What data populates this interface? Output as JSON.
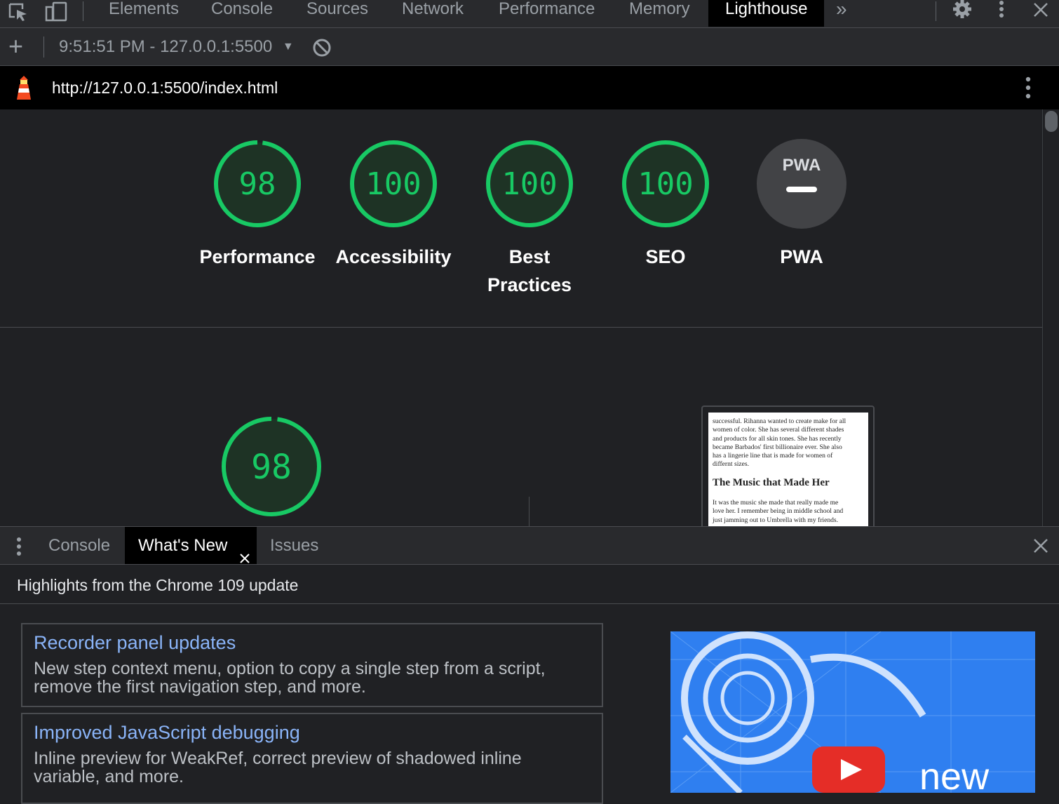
{
  "devtools": {
    "tabs": [
      "Elements",
      "Console",
      "Sources",
      "Network",
      "Performance",
      "Memory",
      "Lighthouse"
    ],
    "active_tab": "Lighthouse",
    "more_tabs": "»"
  },
  "toolbar": {
    "add_label": "+",
    "report_selector": "9:51:51 PM - 127.0.0.1:5500",
    "dropdown_arrow": "▼"
  },
  "urlbar": {
    "url": "http://127.0.0.1:5500/index.html"
  },
  "categories": [
    {
      "score": "98",
      "label": "Performance",
      "value": 98
    },
    {
      "score": "100",
      "label": "Accessibility",
      "value": 100
    },
    {
      "score": "100",
      "label": "Best Practices",
      "label_line1": "Best",
      "label_line2": "Practices",
      "value": 100
    },
    {
      "score": "100",
      "label": "SEO",
      "value": 100
    },
    {
      "score": "",
      "label": "PWA",
      "badge": "PWA"
    }
  ],
  "performance_detail": {
    "score": "98",
    "value": 98
  },
  "screenshot": {
    "para1_lines": [
      "successful. Rihanna wanted to create make for all",
      "women of color. She has several different shades",
      "and products for all skin tones. She has recently",
      "became Barbados' first billionaire ever. She also",
      "has a lingerie line that is made for women of",
      "differnt sizes."
    ],
    "heading": "The Music that Made Her",
    "para2_lines": [
      "It was the music she made that really made me",
      "love her. I remember being in middle school and",
      "just jamming out to Umbrella with my friends."
    ]
  },
  "drawer": {
    "tabs": [
      "Console",
      "What's New",
      "Issues"
    ],
    "active_tab": "What's New",
    "highlights_title": "Highlights from the Chrome 109 update",
    "cards": [
      {
        "title": "Recorder panel updates",
        "desc_line1": "New step context menu, option to copy a single step from a script,",
        "desc_line2": "remove the first navigation step, and more."
      },
      {
        "title": "Improved JavaScript debugging",
        "desc_line1": "Inline preview for WeakRef, correct preview of shadowed inline",
        "desc_line2": "variable, and more."
      }
    ],
    "video_caption": "new"
  },
  "colors": {
    "pass_green": "#18c964",
    "gauge_bg": "#1e3325",
    "link_blue": "#8ab4f8",
    "lighthouse_orange": "#f44b21"
  }
}
